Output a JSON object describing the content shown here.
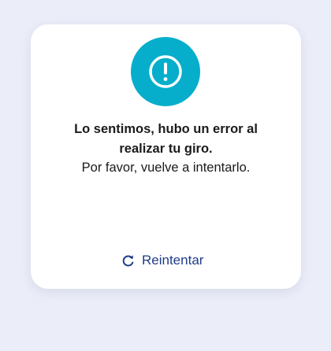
{
  "colors": {
    "page_background": "#ebeef9",
    "card_background": "#ffffff",
    "alert_accent": "#06aecb",
    "link": "#1f3c88"
  },
  "error_card": {
    "icon": "alert-circle-icon",
    "title": "Lo sentimos, hubo un error al realizar tu giro.",
    "subtitle": "Por favor, vuelve a intentarlo.",
    "retry": {
      "icon": "refresh-icon",
      "label": "Reintentar"
    }
  }
}
